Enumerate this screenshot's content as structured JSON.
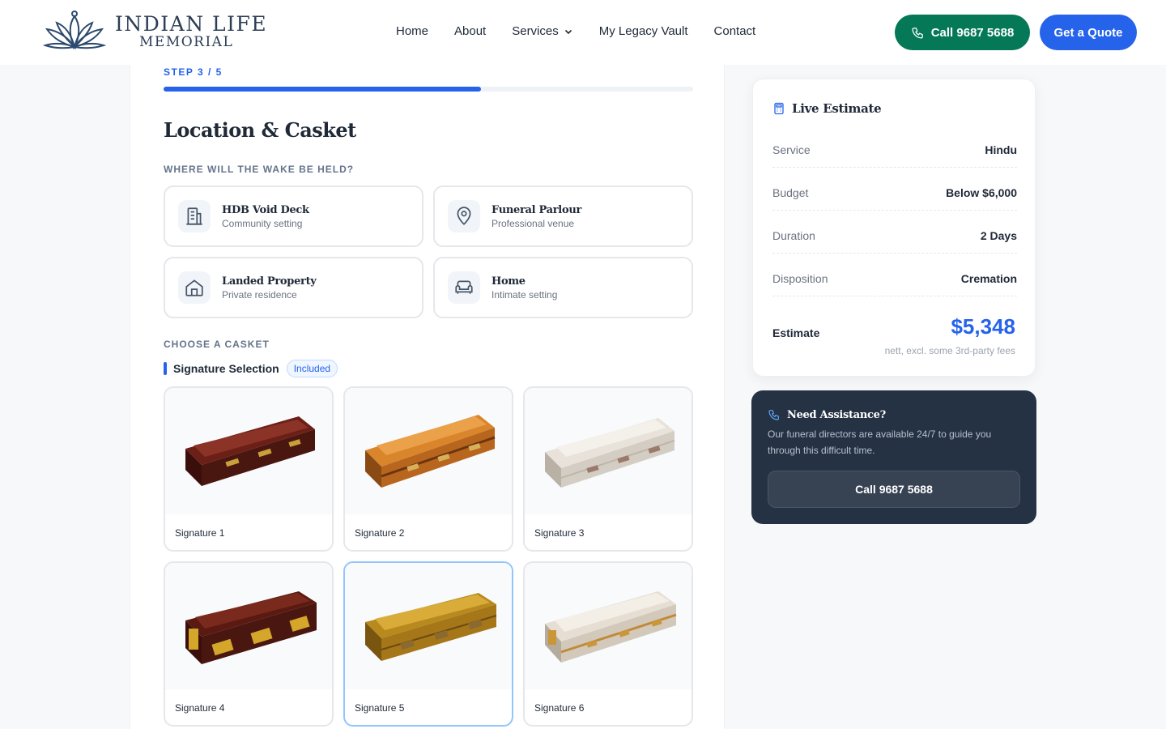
{
  "brand": {
    "name_line1": "INDIAN LIFE",
    "name_line2": "MEMORIAL"
  },
  "nav": {
    "items": [
      {
        "label": "Home"
      },
      {
        "label": "About"
      },
      {
        "label": "Services"
      },
      {
        "label": "My Legacy Vault"
      },
      {
        "label": "Contact"
      }
    ]
  },
  "header_actions": {
    "call_label": "Call 9687 5688",
    "quote_label": "Get a Quote"
  },
  "colors": {
    "primary": "#2563eb",
    "call_green": "#047857",
    "dark_panel": "#253244"
  },
  "form": {
    "step": "STEP 3 / 5",
    "progress_percent": 60,
    "title": "Location & Casket",
    "wake_question": "WHERE WILL THE WAKE BE HELD?",
    "wake_options": [
      {
        "title": "HDB Void Deck",
        "subtitle": "Community setting",
        "icon": "building-icon"
      },
      {
        "title": "Funeral Parlour",
        "subtitle": "Professional venue",
        "icon": "map-pin-icon"
      },
      {
        "title": "Landed Property",
        "subtitle": "Private residence",
        "icon": "house-icon"
      },
      {
        "title": "Home",
        "subtitle": "Intimate setting",
        "icon": "sofa-icon"
      }
    ],
    "casket_question": "CHOOSE A CASKET",
    "casket_group": {
      "title": "Signature Selection",
      "badge": "Included"
    },
    "caskets": [
      {
        "name": "Signature 1",
        "color": "dark-mahogany"
      },
      {
        "name": "Signature 2",
        "color": "orange-wood"
      },
      {
        "name": "Signature 3",
        "color": "white"
      },
      {
        "name": "Signature 4",
        "color": "dark-mahogany-gold"
      },
      {
        "name": "Signature 5",
        "color": "gold",
        "selected": true
      },
      {
        "name": "Signature 6",
        "color": "white-gold"
      }
    ]
  },
  "estimate": {
    "title": "Live Estimate",
    "rows": [
      {
        "label": "Service",
        "value": "Hindu"
      },
      {
        "label": "Budget",
        "value": "Below $6,000"
      },
      {
        "label": "Duration",
        "value": "2 Days"
      },
      {
        "label": "Disposition",
        "value": "Cremation"
      }
    ],
    "total_label": "Estimate",
    "total_value": "$5,348",
    "note": "nett, excl. some 3rd-party fees"
  },
  "assistance": {
    "title": "Need Assistance?",
    "text": "Our funeral directors are available 24/7 to guide you through this difficult time.",
    "button": "Call 9687 5688"
  }
}
